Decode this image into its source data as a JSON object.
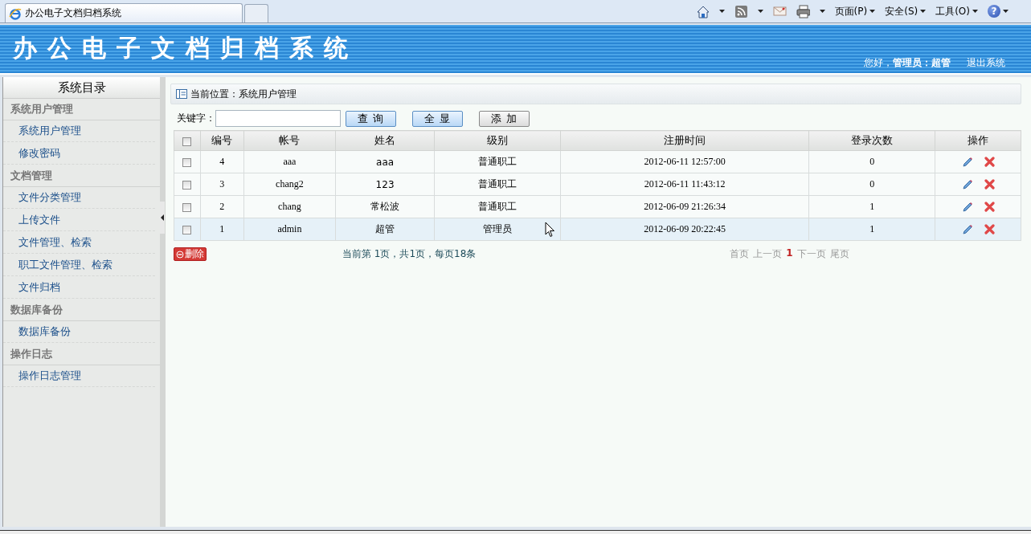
{
  "browser": {
    "tab_title": "办公电子文档归档系统",
    "commands": [
      {
        "kind": "home"
      },
      {
        "kind": "feed"
      },
      {
        "kind": "mail"
      },
      {
        "kind": "print"
      },
      {
        "kind": "menu",
        "label": "页面(P)"
      },
      {
        "kind": "menu",
        "label": "安全(S)"
      },
      {
        "kind": "menu",
        "label": "工具(O)"
      },
      {
        "kind": "help",
        "label": "?"
      }
    ]
  },
  "header": {
    "title": "办公电子文档归档系统",
    "greeting": "您好，**管理员：超管**",
    "logout": "退出系统"
  },
  "sidebar": {
    "title": "系统目录",
    "groups": [
      {
        "label": "系统用户管理",
        "items": [
          {
            "label": "系统用户管理"
          },
          {
            "label": "修改密码"
          }
        ]
      },
      {
        "label": "文档管理",
        "items": [
          {
            "label": "文件分类管理"
          },
          {
            "label": "上传文件"
          },
          {
            "label": "文件管理、检索"
          },
          {
            "label": "职工文件管理、检索"
          },
          {
            "label": "文件归档"
          }
        ]
      },
      {
        "label": "数据库备份",
        "items": [
          {
            "label": "数据库备份"
          }
        ]
      },
      {
        "label": "操作日志",
        "items": [
          {
            "label": "操作日志管理"
          }
        ]
      }
    ]
  },
  "breadcrumb": "当前位置：系统用户管理",
  "search": {
    "label": "关键字：",
    "buttons": [
      {
        "label": "查 询",
        "kind": "primary"
      },
      {
        "label": "全 显",
        "kind": "primary"
      },
      {
        "label": "添 加",
        "kind": "secondary"
      }
    ]
  },
  "table": {
    "select_all_checked": false,
    "columns": [
      "编号",
      "帐号",
      "姓名",
      "级别",
      "注册时间",
      "登录次数",
      "操作"
    ],
    "rows": [
      {
        "checked": false,
        "hovered": false,
        "cells": [
          "4",
          "aaa",
          "aaa",
          "普通职工",
          "2012-06-11 12:57:00",
          "0"
        ]
      },
      {
        "checked": false,
        "hovered": false,
        "cells": [
          "3",
          "chang2",
          "123",
          "普通职工",
          "2012-06-11 11:43:12",
          "0"
        ]
      },
      {
        "checked": false,
        "hovered": false,
        "cells": [
          "2",
          "chang",
          "常松波",
          "普通职工",
          "2012-06-09 21:26:34",
          "1"
        ]
      },
      {
        "checked": false,
        "hovered": true,
        "cells": [
          "1",
          "admin",
          "超管",
          "管理员",
          "2012-06-09 20:22:45",
          "1"
        ]
      }
    ]
  },
  "footer": {
    "delete_button": "删除",
    "page_info": "当前第 1页，共1页，每页18条",
    "pager": [
      {
        "label": "首页",
        "current": false
      },
      {
        "label": "上一页",
        "current": false
      },
      {
        "label": "1",
        "current": true
      },
      {
        "label": "下一页",
        "current": false
      },
      {
        "label": "尾页",
        "current": false
      }
    ]
  }
}
